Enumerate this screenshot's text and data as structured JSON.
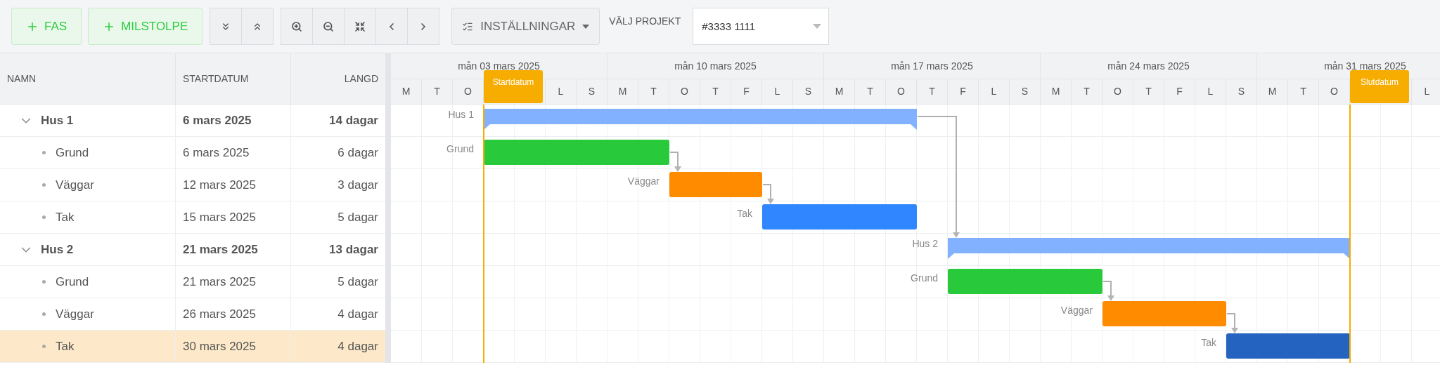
{
  "toolbar": {
    "add_buttons": [
      {
        "label": "FAS"
      },
      {
        "label": "MILSTOLPE"
      }
    ],
    "settings_button": {
      "label": "INSTÄLLNINGAR"
    },
    "project_label": "VÄLJ PROJEKT",
    "project_select": {
      "value": "#3333 1111"
    }
  },
  "grid": {
    "columns": [
      "NAMN",
      "STARTDATUM",
      "LANGD"
    ]
  },
  "timeline": {
    "weeks": [
      {
        "label": "mån 03 mars 2025",
        "days": [
          "M",
          "T",
          "O",
          "L",
          "S"
        ]
      },
      {
        "label": "mån 10 mars 2025",
        "days": [
          "M",
          "T",
          "O",
          "T",
          "F",
          "L",
          "S"
        ]
      },
      {
        "label": "mån 17 mars 2025",
        "days": [
          "M",
          "T",
          "O",
          "T",
          "F",
          "L",
          "S"
        ]
      },
      {
        "label": "mån 24 mars 2025",
        "days": [
          "M",
          "T",
          "O",
          "T",
          "F",
          "L",
          "S"
        ]
      },
      {
        "label": "mån 31 mars 2025",
        "days": [
          "M",
          "T",
          "O",
          "L"
        ]
      }
    ],
    "markers": [
      {
        "kind": "start",
        "label": "Startdatum"
      },
      {
        "kind": "end",
        "label": "Slutdatum"
      }
    ]
  },
  "groups": [
    {
      "name": "Hus 1",
      "start": "6 mars 2025",
      "length": "14 dagar",
      "expanded": true,
      "selected": false,
      "bar_label": "Hus 1",
      "color": "#82b1ff",
      "arrow_to_next": true,
      "children": [
        {
          "name": "Grund",
          "start": "6 mars 2025",
          "length": "6 dagar",
          "selected": false,
          "bar_label": "Grund",
          "color": "#28c93a",
          "arrow_to_next": true
        },
        {
          "name": "Väggar",
          "start": "12 mars 2025",
          "length": "3 dagar",
          "selected": false,
          "bar_label": "Väggar",
          "color": "#ff8c00",
          "arrow_to_next": true
        },
        {
          "name": "Tak",
          "start": "15 mars 2025",
          "length": "5 dagar",
          "selected": false,
          "bar_label": "Tak",
          "color": "#2f86ff",
          "arrow_to_next": false
        }
      ]
    },
    {
      "name": "Hus 2",
      "start": "21 mars 2025",
      "length": "13 dagar",
      "expanded": true,
      "selected": false,
      "bar_label": "Hus 2",
      "color": "#82b1ff",
      "arrow_to_next": false,
      "children": [
        {
          "name": "Grund",
          "start": "21 mars 2025",
          "length": "5 dagar",
          "selected": false,
          "bar_label": "Grund",
          "color": "#28c93a",
          "arrow_to_next": true
        },
        {
          "name": "Väggar",
          "start": "26 mars 2025",
          "length": "4 dagar",
          "selected": false,
          "bar_label": "Väggar",
          "color": "#ff8c00",
          "arrow_to_next": true
        },
        {
          "name": "Tak",
          "start": "30 mars 2025",
          "length": "4 dagar",
          "selected": true,
          "bar_label": "Tak",
          "color": "#2463bf",
          "arrow_to_next": false
        }
      ]
    }
  ]
}
